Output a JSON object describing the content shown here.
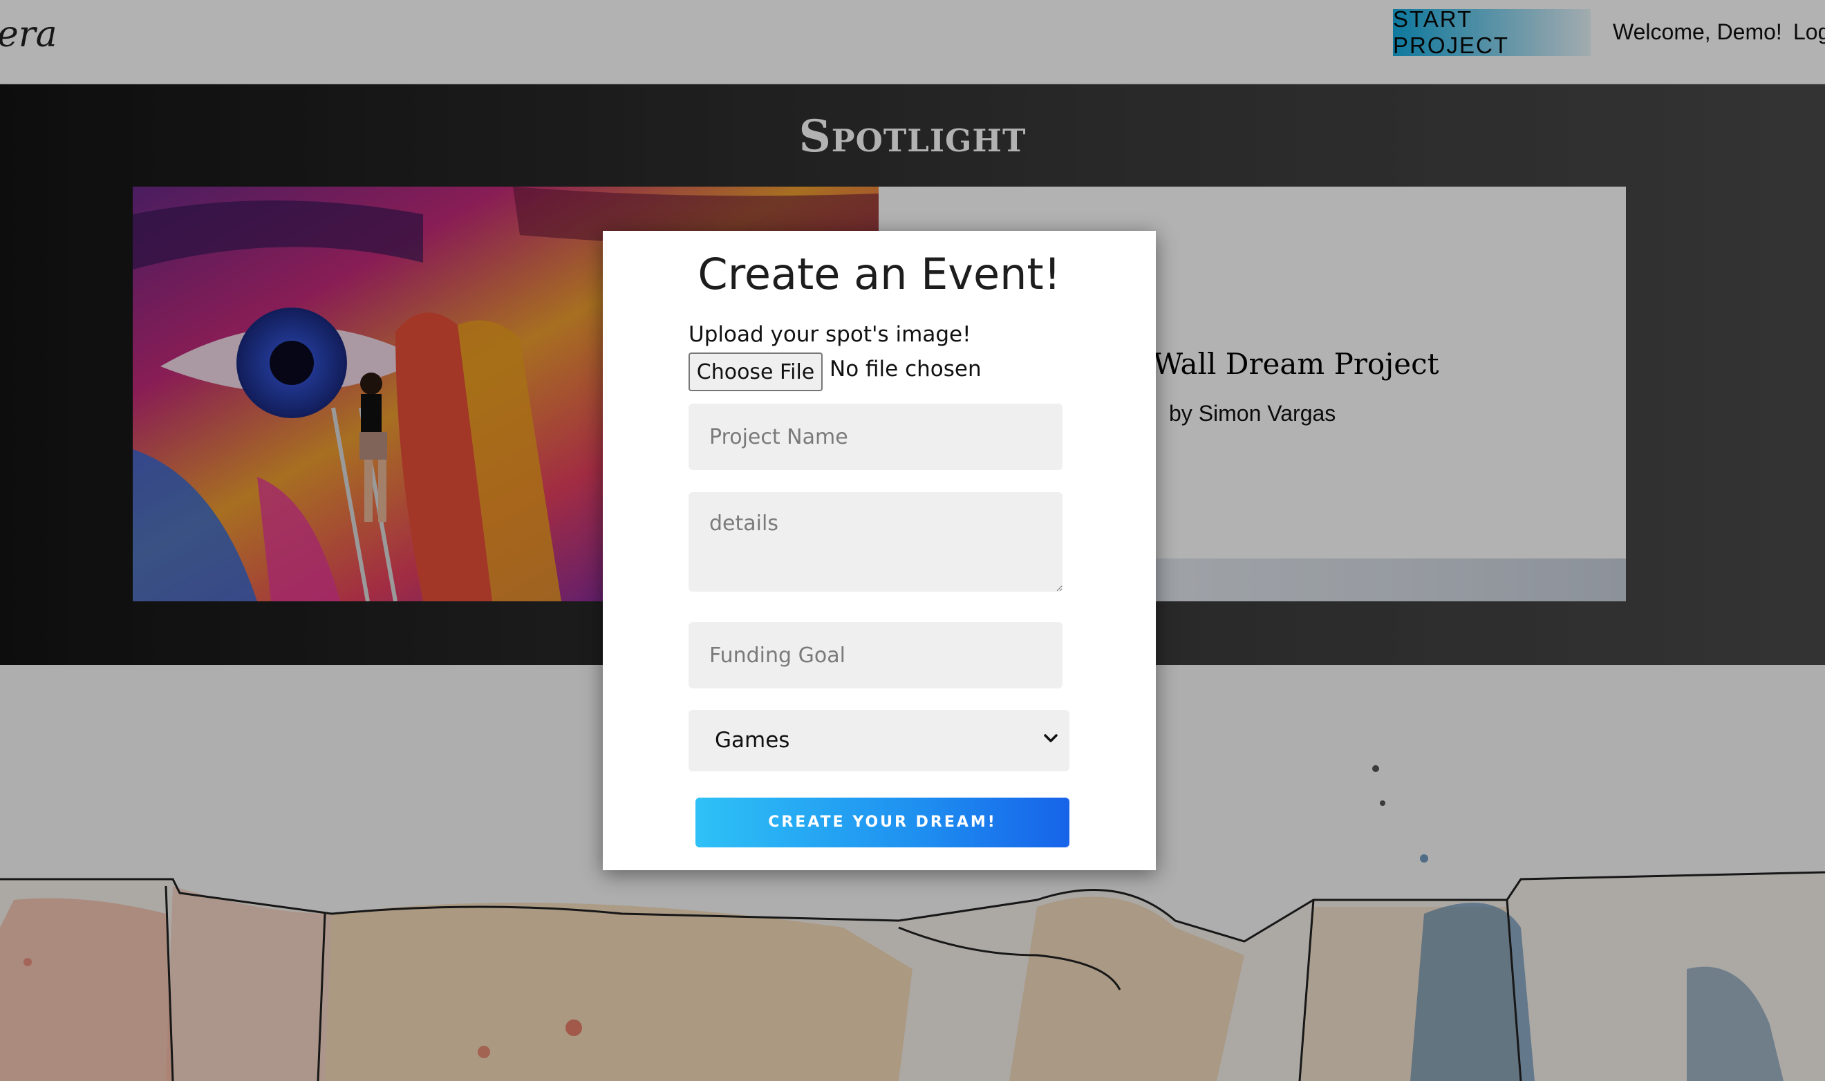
{
  "navbar": {
    "brand": "era",
    "start_project_label": "START PROJECT",
    "welcome_text": "Welcome, Demo!",
    "logout_label": "Log"
  },
  "spotlight": {
    "title": "Spotlight",
    "card_title": "Wall Dream Project",
    "card_author": "by Simon Vargas"
  },
  "modal": {
    "title": "Create an Event!",
    "upload_label": "Upload your spot's image!",
    "choose_file_label": "Choose File",
    "no_file_text": "No file chosen",
    "project_name_placeholder": "Project Name",
    "details_placeholder": "details",
    "funding_goal_placeholder": "Funding Goal",
    "category_selected": "Games",
    "submit_label": "CREATE YOUR DREAM!"
  },
  "icons": {
    "select_chevron": "chevron-down-icon"
  },
  "colors": {
    "start_project_gradient": "#15aee3",
    "submit_gradient_start": "#2ec1f6",
    "submit_gradient_end": "#1763e9",
    "overlay": "rgba(0,0,0,0.30)"
  }
}
